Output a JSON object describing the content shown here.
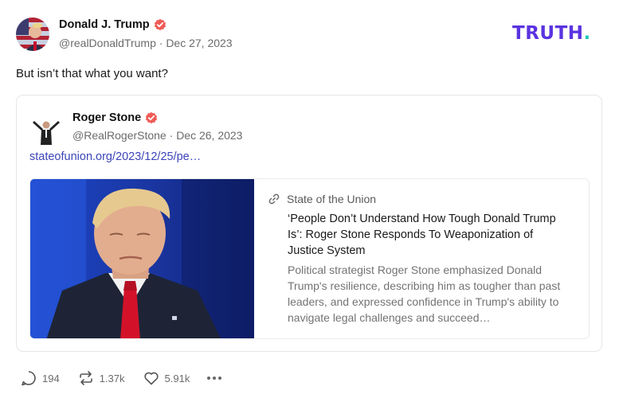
{
  "brand": {
    "logo_text": "TRUTH",
    "logo_dot": ".",
    "colors": {
      "primary": "#5a33e0",
      "accent": "#20c9b8"
    }
  },
  "post": {
    "author_name": "Donald J. Trump",
    "handle": "@realDonaldTrump",
    "separator": "·",
    "date": "Dec 27, 2023",
    "text": "But isn’t that what you want?",
    "verified_icon": "verified-badge-icon",
    "verified_color": "#ef5b56"
  },
  "quote": {
    "author_name": "Roger Stone",
    "handle": "@RealRogerStone",
    "separator": "·",
    "date": "Dec 26, 2023",
    "link_text": "stateofunion.org/2023/12/25/pe…",
    "link_color": "#3b44b8",
    "card": {
      "source": "State of the Union",
      "source_icon": "link-icon",
      "title": "‘People Don’t Understand How Tough Donald Trump Is’: Roger Stone Responds To Weaponization of Justice System",
      "description": "Political strategist Roger Stone emphasized Donald Trump's resilience, describing him as tougher than past leaders, and expressed confidence in Trump's ability to navigate legal challenges and succeed…"
    }
  },
  "actions": {
    "replies": "194",
    "retruths": "1.37k",
    "likes": "5.91k"
  }
}
